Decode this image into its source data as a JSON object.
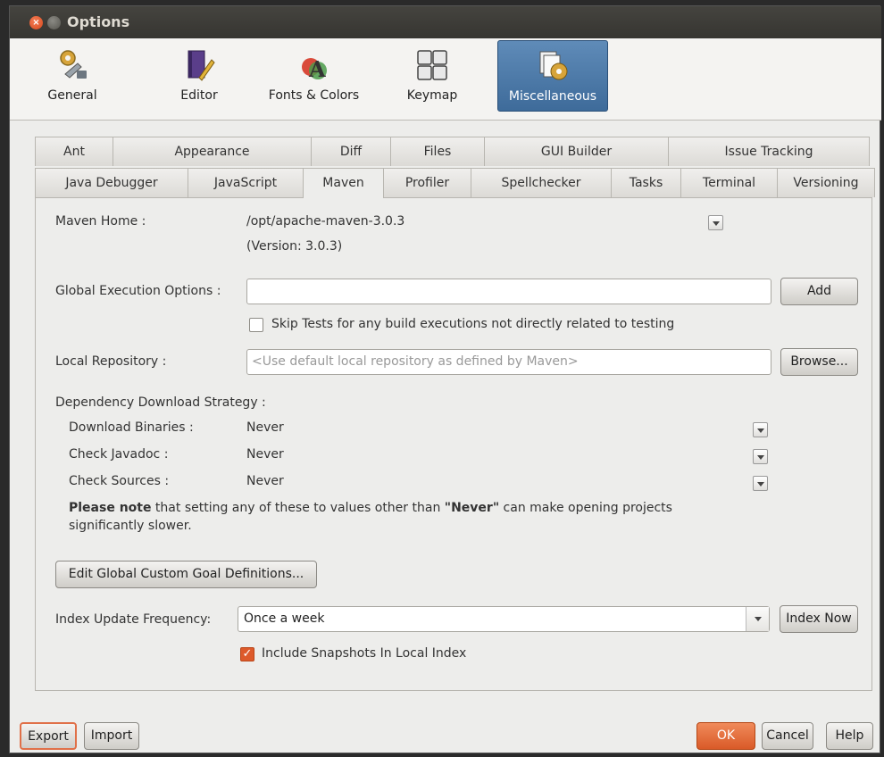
{
  "window": {
    "title": "Options"
  },
  "categories": [
    {
      "label": "General",
      "icon": "gear-wrench-icon"
    },
    {
      "label": "Editor",
      "icon": "editor-book-pen-icon"
    },
    {
      "label": "Fonts & Colors",
      "icon": "fonts-colors-icon"
    },
    {
      "label": "Keymap",
      "icon": "keyboard-icon"
    },
    {
      "label": "Miscellaneous",
      "icon": "miscellaneous-icon",
      "selected": true
    }
  ],
  "tabs_top": [
    "Ant",
    "Appearance",
    "Diff",
    "Files",
    "GUI Builder",
    "Issue Tracking"
  ],
  "tabs_bottom": [
    "Java Debugger",
    "JavaScript",
    "Maven",
    "Profiler",
    "Spellchecker",
    "Tasks",
    "Terminal",
    "Versioning"
  ],
  "active_tab": "Maven",
  "maven": {
    "home_label": "Maven Home :",
    "home_value": "/opt/apache-maven-3.0.3",
    "version": "(Version: 3.0.3)",
    "global_exec_label": "Global Execution Options :",
    "global_exec_value": "",
    "add_button": "Add",
    "skip_tests_label": "Skip Tests for any build executions not directly related to testing",
    "skip_tests_checked": false,
    "local_repo_label": "Local Repository :",
    "local_repo_placeholder": "<Use default local repository as defined by Maven>",
    "browse_button": "Browse...",
    "dep_strategy_label": "Dependency Download Strategy :",
    "download_binaries_label": "Download Binaries :",
    "download_binaries_value": "Never",
    "check_javadoc_label": "Check Javadoc :",
    "check_javadoc_value": "Never",
    "check_sources_label": "Check Sources :",
    "check_sources_value": "Never",
    "note_bold": "Please note",
    "note_mid": " that setting any of these to values other than ",
    "note_never": "\"Never\"",
    "note_end": " can make opening projects",
    "note_line2": "significantly slower.",
    "edit_goals_button": "Edit Global Custom Goal Definitions...",
    "index_freq_label": "Index Update Frequency:",
    "index_freq_value": "Once a week",
    "index_now_button": "Index Now",
    "include_snapshots_label": "Include Snapshots In Local Index",
    "include_snapshots_checked": true
  },
  "footer": {
    "export": "Export",
    "import": "Import",
    "ok": "OK",
    "cancel": "Cancel",
    "help": "Help"
  },
  "colors": {
    "accent": "#dd5a2b",
    "selected_category": "#4a77a6",
    "titlebar": "#3c3b37"
  }
}
